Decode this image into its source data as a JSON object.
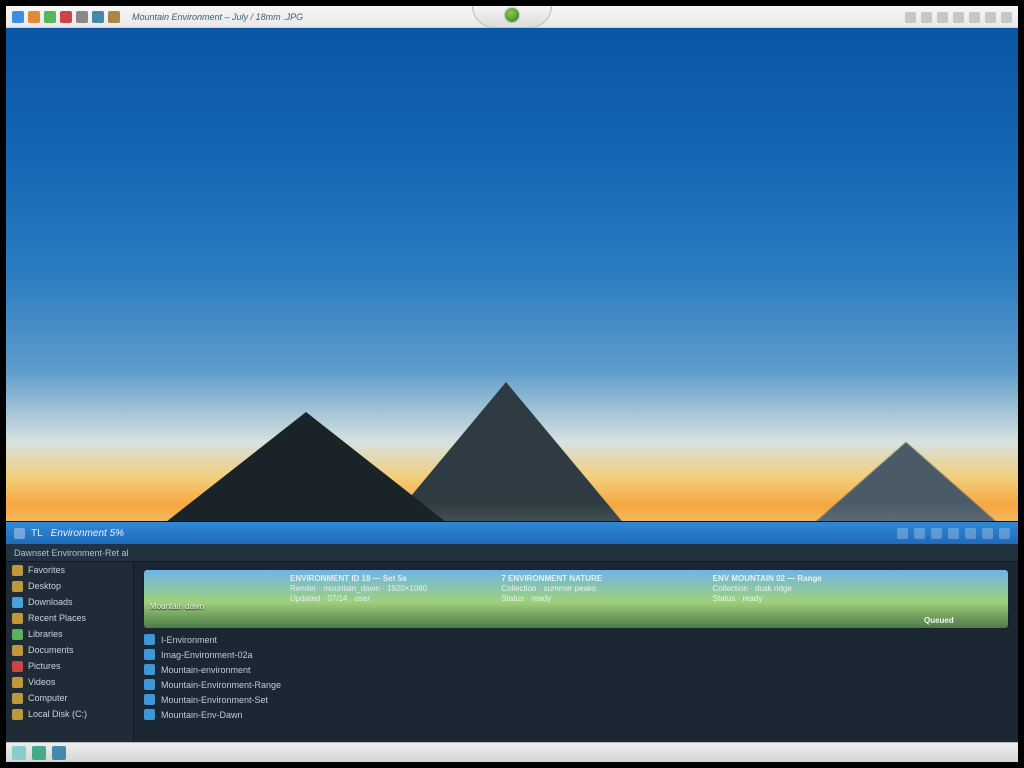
{
  "titlebar": {
    "title": "Mountain Environment – July / 18mm .JPG",
    "icon_colors": [
      "#3a8fe0",
      "#e08a3a",
      "#58b55a",
      "#c44",
      "#888",
      "#48a",
      "#a84"
    ]
  },
  "explorer": {
    "title_left": "TL",
    "title_text": "Environment 5%",
    "subtitle": "Dawnset Environment-Ret al",
    "side_items": [
      "Favorites",
      "Desktop",
      "Downloads",
      "Recent Places",
      "Libraries",
      "Documents",
      "Pictures",
      "Videos",
      "Computer",
      "Local Disk (C:)"
    ],
    "cards": {
      "thumb_caption": "Mountain dawn",
      "blue": {
        "h": "ENVIRONMENT ID 18 — Set 5a",
        "l1": "Render · mountain_dawn · 1920×1080",
        "l2": "Updated · 07/14 · user"
      },
      "green": {
        "h": "7 ENVIRONMENT NATURE",
        "l1": "Collection · summer peaks",
        "l2": "Status · ready"
      },
      "green2": {
        "h": "ENV MOUNTAIN 02 — Range",
        "l1": "Collection · dusk ridge",
        "l2": "Status · ready"
      },
      "orange_label": "Queued"
    },
    "file_rows": [
      "I-Environment",
      "Imag-Environment-02a",
      "Mountain-environment",
      "Mountain-Environment-Range",
      "Mountain-Environment-Set",
      "Mountain-Env-Dawn"
    ]
  },
  "taskbar": {
    "label": ""
  }
}
